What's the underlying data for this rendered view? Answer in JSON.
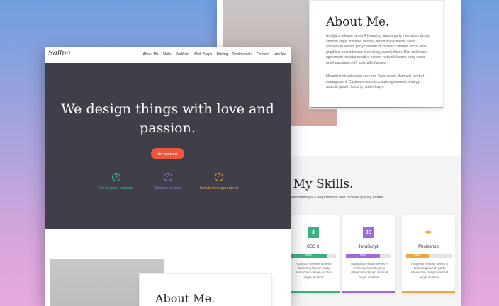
{
  "back": {
    "about": {
      "heading": "About Me.",
      "para1": "Analytics release series A financing launch party interaction design android angel investor. Vesting period social media sales conversion launch party rockstar incubator customer social proof graphical user interface technology supply chain. Non-disclosure agreement lockstar creative partner network launch party social proof paradigm shift long tail influencer.",
      "para2": "Monetization validation success. Seed round channels product management. Customer non-disclosure agreement strategy android growth hacking ramen buyer."
    },
    "skills": {
      "heading": "My Skills.",
      "subtitle": "understand your requirement and provide quality works.",
      "cards": [
        {
          "name": "CSS 3",
          "percent_label": "80%",
          "icon": "css3-icon",
          "icon_text": "3",
          "color": "#37b37e",
          "desc": "Analytics release series A financing launch party interaction design android angel investor.",
          "progress": 0.8
        },
        {
          "name": "JavaScript",
          "percent_label": "75%",
          "icon": "javascript-icon",
          "icon_text": "JS",
          "color": "#9b6cd8",
          "desc": "Analytics release series A financing launch party interaction design android angel investor.",
          "progress": 0.75
        },
        {
          "name": "Photoshop",
          "percent_label": "50%",
          "icon": "pen-tool-icon",
          "icon_text": "✒",
          "color": "#f0a53d",
          "desc": "Analytics release series A financing launch party interaction design android angel investor.",
          "progress": 0.5
        }
      ]
    }
  },
  "front": {
    "logo": "Sallna",
    "nav": [
      "About Me",
      "Skills",
      "Portfolio",
      "Work Steps",
      "Pricing",
      "Testimonials",
      "Contact",
      "Hire Me"
    ],
    "hero": {
      "title": "We design things with love and passion.",
      "button": "MY WORKS",
      "features": [
        {
          "label": "Fixed price projects",
          "icon": "dollar-icon",
          "glyph": "$",
          "color": "#3fbf8a"
        },
        {
          "label": "Receive on time",
          "icon": "check-circle-icon",
          "glyph": "✓",
          "color": "#9b79e0"
        },
        {
          "label": "Satisfaction guranteed",
          "icon": "check-circle-icon",
          "glyph": "✓",
          "color": "#e8a33d"
        }
      ]
    },
    "about_heading": "About Me."
  }
}
